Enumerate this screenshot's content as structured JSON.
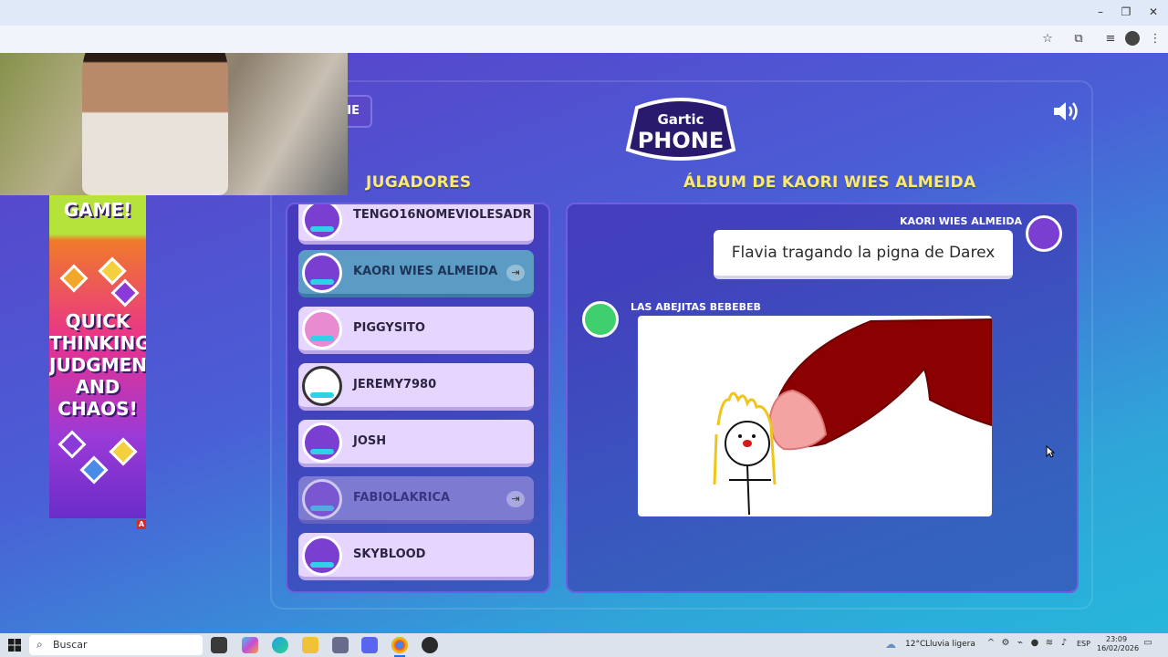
{
  "browser": {
    "window_controls": {
      "minimize": "–",
      "maximize": "❐",
      "close": "✕"
    },
    "toolbar_icons": [
      "star-icon",
      "extensions-icon",
      "media-icon",
      "profile-icon",
      "menu-icon"
    ]
  },
  "game": {
    "logo": {
      "line1": "Gartic",
      "line2": "PHONE"
    },
    "back_button_label": "IE",
    "players_title": "JUGADORES",
    "album_title": "ÁLBUM DE KAORI WIES ALMEIDA",
    "players": [
      {
        "name": "TENGO16NOMEVIOLESADR",
        "state": "normal",
        "avatar": "purple-bird"
      },
      {
        "name": "KAORI WIES ALMEIDA",
        "state": "highlighted",
        "avatar": "purple-bird",
        "exit_icon": true
      },
      {
        "name": "PIGGYSITO",
        "state": "normal",
        "avatar": "pig"
      },
      {
        "name": "JEREMY7980",
        "state": "normal",
        "avatar": "panda"
      },
      {
        "name": "JOSH",
        "state": "normal",
        "avatar": "purple-bird"
      },
      {
        "name": "FABIOLAKRICA",
        "state": "faded",
        "avatar": "purple-bird",
        "exit_icon": true
      },
      {
        "name": "SKYBLOOD",
        "state": "normal",
        "avatar": "purple-bird"
      }
    ],
    "album": {
      "phrase_author": "KAORI WIES ALMEIDA",
      "phrase_text": "Flavia tragando la pigna de Darex",
      "drawing_author": "LAS ABEJITAS BEBEBEB"
    }
  },
  "ad": {
    "top_text": "GAME!",
    "headline": "QUICK THINKING, JUDGMENT AND CHAOS!",
    "badge": "A"
  },
  "taskbar": {
    "search_placeholder": "Buscar",
    "weather_temp": "12°C",
    "weather_desc": "Lluvia ligera",
    "language": "ESP",
    "time": "23:09",
    "date": "16/02/2026",
    "apps": [
      "task-view-icon",
      "copilot-icon",
      "edge-icon",
      "file-explorer-icon",
      "store-icon",
      "discord-icon",
      "chrome-icon",
      "obs-icon"
    ]
  },
  "colors": {
    "title_yellow": "#fcea6b",
    "card_lilac": "#e6d6ff",
    "card_teal": "#5b9bc4",
    "panel_purple": "#3c28aa"
  }
}
